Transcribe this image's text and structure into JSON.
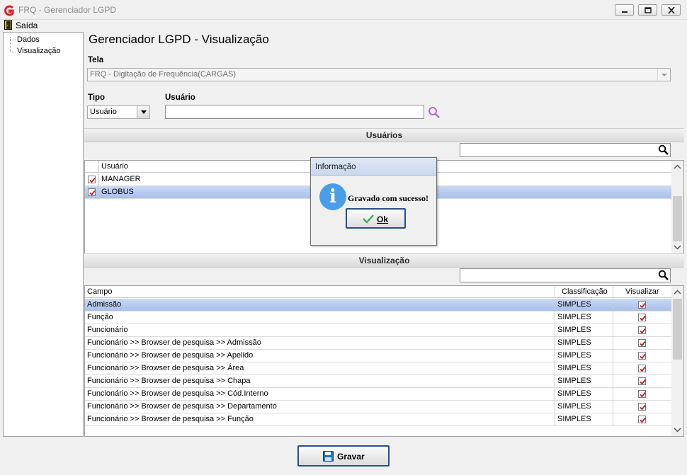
{
  "window": {
    "title": "FRQ - Gerenciador LGPD"
  },
  "menu": {
    "exit_label": "Saída"
  },
  "tree": {
    "items": [
      "Dados",
      "Visualização"
    ]
  },
  "page": {
    "title": "Gerenciador LGPD - Visualização"
  },
  "tela": {
    "label": "Tela",
    "value": "FRQ - Digitação de Frequência(CARGAS)"
  },
  "tipo": {
    "label": "Tipo",
    "value": "Usuário"
  },
  "usuario": {
    "label": "Usuário",
    "value": ""
  },
  "users_section": {
    "title": "Usuários",
    "column": "Usuário",
    "rows": [
      {
        "name": "MANAGER",
        "checked": true,
        "selected": false
      },
      {
        "name": "GLOBUS",
        "checked": true,
        "selected": true
      }
    ]
  },
  "view_section": {
    "title": "Visualização",
    "columns": [
      "Campo",
      "Classificação",
      "Visualizar"
    ],
    "rows": [
      {
        "campo": "Admissão",
        "classificacao": "SIMPLES",
        "visualizar": true,
        "selected": true
      },
      {
        "campo": "Função",
        "classificacao": "SIMPLES",
        "visualizar": true
      },
      {
        "campo": "Funcionário",
        "classificacao": "SIMPLES",
        "visualizar": true
      },
      {
        "campo": "Funcionário >> Browser de pesquisa >> Admissão",
        "classificacao": "SIMPLES",
        "visualizar": true
      },
      {
        "campo": "Funcionário >> Browser de pesquisa >> Apelido",
        "classificacao": "SIMPLES",
        "visualizar": true
      },
      {
        "campo": "Funcionário >> Browser de pesquisa >> Área",
        "classificacao": "SIMPLES",
        "visualizar": true
      },
      {
        "campo": "Funcionário >> Browser de pesquisa >> Chapa",
        "classificacao": "SIMPLES",
        "visualizar": true
      },
      {
        "campo": "Funcionário >> Browser de pesquisa >> Cód.Interno",
        "classificacao": "SIMPLES",
        "visualizar": true
      },
      {
        "campo": "Funcionário >> Browser de pesquisa >> Departamento",
        "classificacao": "SIMPLES",
        "visualizar": true
      },
      {
        "campo": "Funcionário >> Browser de pesquisa >> Função",
        "classificacao": "SIMPLES",
        "visualizar": true
      }
    ]
  },
  "dialog": {
    "title": "Informação",
    "message": "Gravado com sucesso!",
    "ok_label": "Ok"
  },
  "actions": {
    "save_label": "Gravar"
  },
  "colors": {
    "selection": "#b3c7ee",
    "check": "#c0182a",
    "accent": "#2a4f8a",
    "info": "#4a9ee8"
  }
}
